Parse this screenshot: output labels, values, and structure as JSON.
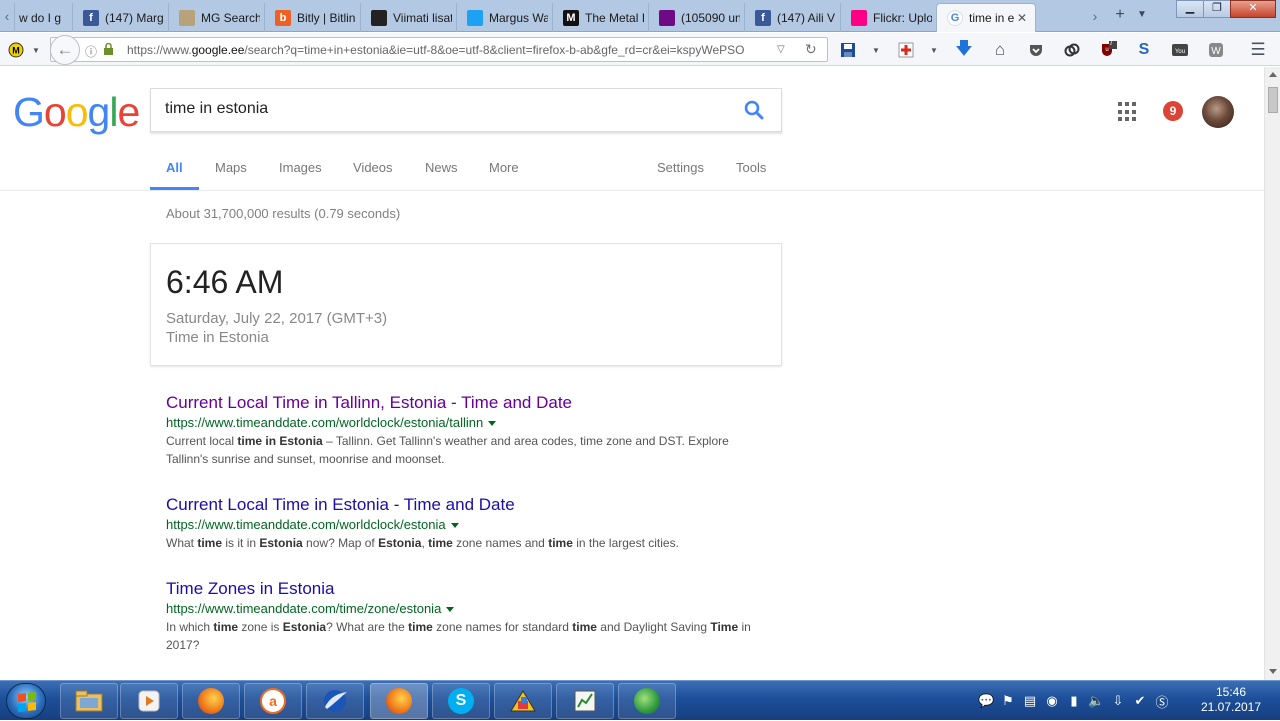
{
  "browser": {
    "tabs": [
      {
        "label": "w do I g",
        "favicon": "",
        "favicon_color": "#b3c8e2"
      },
      {
        "label": "(147) Marg",
        "favicon": "f",
        "favicon_color": "#3b5998"
      },
      {
        "label": "MG Search",
        "favicon": "",
        "favicon_color": "#b8a27a"
      },
      {
        "label": "Bitly | Bitlin",
        "favicon": "b",
        "favicon_color": "#ee6123"
      },
      {
        "label": "Viimati lisat",
        "favicon": "",
        "favicon_color": "#222222"
      },
      {
        "label": "Margus Wa",
        "favicon": "",
        "favicon_color": "#1da1f2"
      },
      {
        "label": "The Metal I",
        "favicon": "M",
        "favicon_color": "#111111"
      },
      {
        "label": "(105090 un",
        "favicon": "",
        "favicon_color": "#6e0a84"
      },
      {
        "label": "(147) Aili V",
        "favicon": "f",
        "favicon_color": "#3b5998"
      },
      {
        "label": "Flickr: Uplo",
        "favicon": "",
        "favicon_color": "#ff0084"
      }
    ],
    "active_tab": {
      "label": "time in e",
      "favicon": "G"
    },
    "url": {
      "scheme": "https://www.",
      "host": "google.ee",
      "path": "/search?q=time+in+estonia&ie=utf-8&oe=utf-8&client=firefox-b-ab&gfe_rd=cr&ei=kspyWePSO"
    },
    "toolbar_badge": "7"
  },
  "google": {
    "logo": [
      "G",
      "o",
      "o",
      "g",
      "l",
      "e"
    ],
    "logo_colors": [
      "#4285f4",
      "#ea4335",
      "#fbbc05",
      "#4285f4",
      "#34a853",
      "#ea4335"
    ],
    "query": "time in estonia",
    "notifications": "9",
    "tabs": {
      "all": "All",
      "maps": "Maps",
      "images": "Images",
      "videos": "Videos",
      "news": "News",
      "more": "More",
      "settings": "Settings",
      "tools": "Tools"
    },
    "stats": "About 31,700,000 results (0.79 seconds)",
    "time_card": {
      "time": "6:46 AM",
      "date": "Saturday, July 22, 2017 (GMT+3)",
      "place": "Time in Estonia"
    },
    "results": [
      {
        "title": "Current Local Time in Tallinn, Estonia - Time and Date",
        "url": "https://www.timeanddate.com/worldclock/estonia/tallinn",
        "visited": true,
        "snippet": [
          {
            "t": "Current local ",
            "b": false
          },
          {
            "t": "time in Estonia",
            "b": true
          },
          {
            "t": " – Tallinn. Get Tallinn's weather and area codes, time zone and DST. Explore Tallinn's sunrise and sunset, moonrise and moonset.",
            "b": false
          }
        ]
      },
      {
        "title": "Current Local Time in Estonia - Time and Date",
        "url": "https://www.timeanddate.com/worldclock/estonia",
        "visited": false,
        "snippet": [
          {
            "t": "What ",
            "b": false
          },
          {
            "t": "time",
            "b": true
          },
          {
            "t": " is it in ",
            "b": false
          },
          {
            "t": "Estonia",
            "b": true
          },
          {
            "t": " now? Map of ",
            "b": false
          },
          {
            "t": "Estonia",
            "b": true
          },
          {
            "t": ", ",
            "b": false
          },
          {
            "t": "time",
            "b": true
          },
          {
            "t": " zone names and ",
            "b": false
          },
          {
            "t": "time",
            "b": true
          },
          {
            "t": " in the largest cities.",
            "b": false
          }
        ]
      },
      {
        "title": "Time Zones in Estonia",
        "url": "https://www.timeanddate.com/time/zone/estonia",
        "visited": false,
        "snippet": [
          {
            "t": "In which ",
            "b": false
          },
          {
            "t": "time",
            "b": true
          },
          {
            "t": " zone is ",
            "b": false
          },
          {
            "t": "Estonia",
            "b": true
          },
          {
            "t": "? What are the ",
            "b": false
          },
          {
            "t": "time",
            "b": true
          },
          {
            "t": " zone names for standard ",
            "b": false
          },
          {
            "t": "time",
            "b": true
          },
          {
            "t": " and Daylight Saving ",
            "b": false
          },
          {
            "t": "Time",
            "b": true
          },
          {
            "t": " in 2017?",
            "b": false
          }
        ]
      }
    ]
  },
  "taskbar": {
    "clock_time": "15:46",
    "clock_date": "21.07.2017"
  }
}
